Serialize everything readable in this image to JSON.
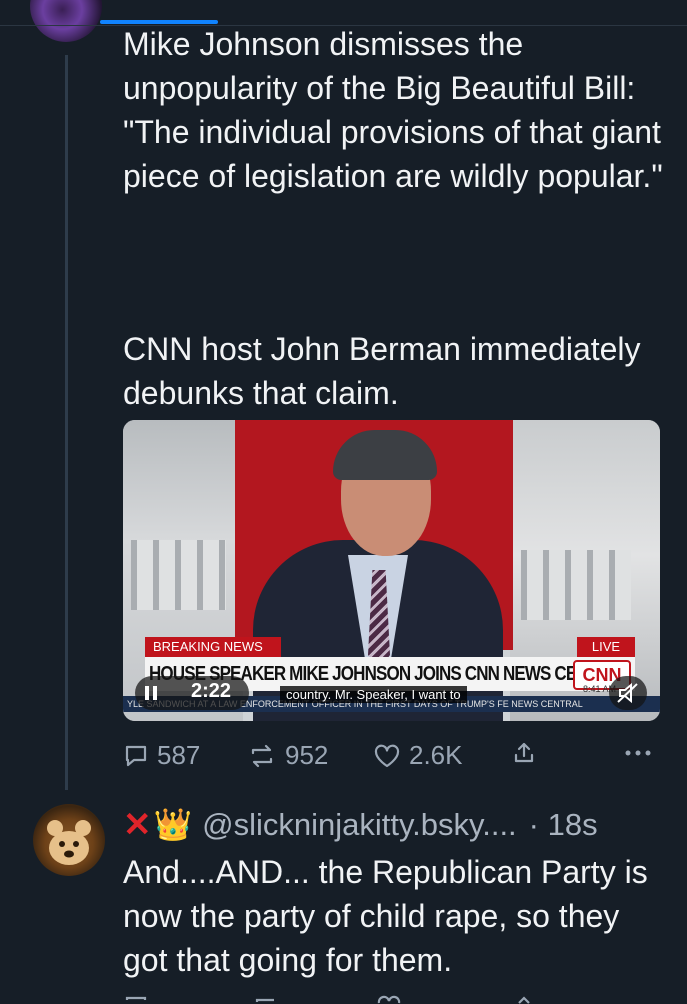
{
  "post": {
    "paragraph_1": "Mike Johnson dismisses the unpopularity of the Big Beautiful Bill: \"The individual provisions of that giant piece of legislation are wildly popular.\"",
    "paragraph_2": "CNN host John Berman immediately debunks that claim.",
    "video": {
      "breaking_label": "BREAKING NEWS",
      "live_label": "LIVE",
      "headline": "HOUSE SPEAKER MIKE JOHNSON JOINS CNN NEWS CENTRAL",
      "logo": "CNN",
      "timestamp": "8:41 AM",
      "ticker": "YLE SANDWICH AT A LAW ENFORCEMENT OFFICER IN THE FIRST DAYS OF TRUMP'S FE  NEWS CENTRAL",
      "duration": "2:22",
      "caption": "country. Mr. Speaker, I want to"
    },
    "actions": {
      "replies": "587",
      "reposts": "952",
      "likes": "2.6K"
    }
  },
  "reply": {
    "emoji": "👑",
    "cross": "✕",
    "handle": "@slickninjakitty.bsky....",
    "time": "· 18s",
    "text": "And....AND... the Republican Party is now the party of child rape, so they got that going for them."
  },
  "colors": {
    "background": "#161e27",
    "accent": "#1083fe",
    "muted": "#9aa6b4",
    "breaking_red": "#c0141c"
  }
}
